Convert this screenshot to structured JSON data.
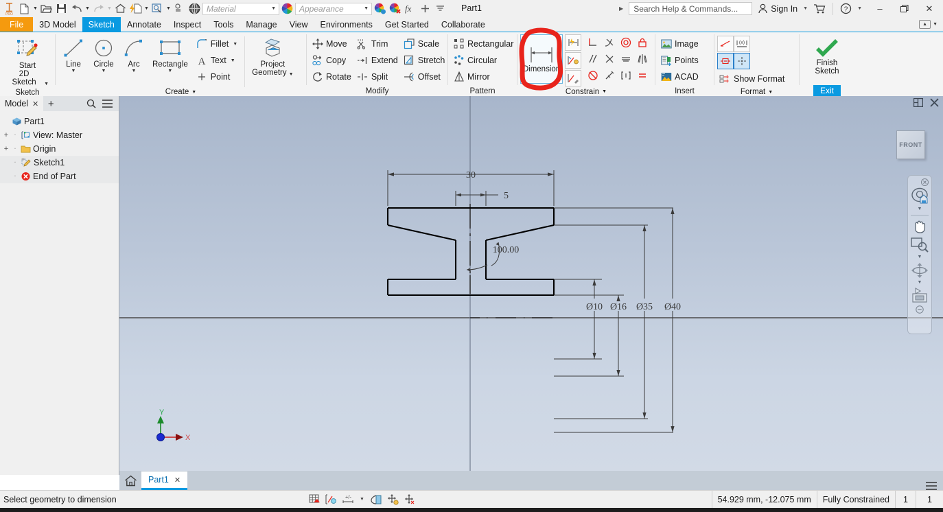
{
  "titlebar": {
    "document_title": "Part1",
    "search_placeholder": "Search Help & Commands...",
    "signin_label": "Sign In",
    "material_value": "Material",
    "appearance_value": "Appearance",
    "minimize": "–",
    "restore": "❐",
    "close": "✕",
    "qat_icons": [
      "new-document-icon",
      "open-folder-icon",
      "save-icon",
      "undo-icon",
      "redo-icon",
      "home-icon",
      "return-icon",
      "select-icon",
      "updates-icon",
      "material-sphere-icon",
      "appearance-sphere-icon",
      "adjust-appearance-icon",
      "clear-appearance-icon",
      "parameters-fx-icon",
      "add-icon",
      "more-icon"
    ]
  },
  "menubar": {
    "items": [
      {
        "label": "File",
        "state": "file"
      },
      {
        "label": "3D Model",
        "state": "normal"
      },
      {
        "label": "Sketch",
        "state": "active"
      },
      {
        "label": "Annotate",
        "state": "normal"
      },
      {
        "label": "Inspect",
        "state": "normal"
      },
      {
        "label": "Tools",
        "state": "normal"
      },
      {
        "label": "Manage",
        "state": "normal"
      },
      {
        "label": "View",
        "state": "normal"
      },
      {
        "label": "Environments",
        "state": "normal"
      },
      {
        "label": "Get Started",
        "state": "normal"
      },
      {
        "label": "Collaborate",
        "state": "normal"
      }
    ]
  },
  "ribbon": {
    "sketch_panel": {
      "label": "Sketch",
      "start_2d_sketch": {
        "line1": "Start",
        "line2": "2D Sketch"
      }
    },
    "create_panel": {
      "label": "Create",
      "line": "Line",
      "circle": "Circle",
      "arc": "Arc",
      "rectangle": "Rectangle",
      "fillet": "Fillet",
      "text": "Text",
      "point": "Point",
      "project_geometry": {
        "line1": "Project",
        "line2": "Geometry"
      }
    },
    "modify_panel": {
      "label": "Modify",
      "move": "Move",
      "copy": "Copy",
      "rotate": "Rotate",
      "trim": "Trim",
      "extend": "Extend",
      "split": "Split",
      "scale": "Scale",
      "stretch": "Stretch",
      "offset": "Offset"
    },
    "pattern_panel": {
      "label": "Pattern",
      "rectangular": "Rectangular",
      "circular": "Circular",
      "mirror": "Mirror"
    },
    "constrain_panel": {
      "label": "Constrain",
      "dimension": "Dimension",
      "highlighted": true,
      "icons": [
        "auto-dimension-icon",
        "show-constraints-icon",
        "constraint-settings-icon",
        "perpendicular-icon",
        "tangent-icon",
        "concentric-icon",
        "fix-icon",
        "parallel-icon",
        "coincident-icon",
        "collinear-icon",
        "symmetric-icon",
        "horizontal-icon",
        "vertical-icon",
        "smooth-icon",
        "equal-icon"
      ]
    },
    "insert_panel": {
      "label": "Insert",
      "image": "Image",
      "points": "Points",
      "acad": "ACAD"
    },
    "format_panel": {
      "label": "Format",
      "show_format": "Show Format",
      "icons": [
        "construction-line-icon",
        "driven-dimension-icon",
        "centerline-icon",
        "center-point-icon"
      ]
    },
    "exit_panel": {
      "finish_sketch": {
        "line1": "Finish",
        "line2": "Sketch"
      },
      "exit_label": "Exit"
    }
  },
  "browser": {
    "tab_label": "Model",
    "close_glyph": "✕",
    "add_glyph": "+",
    "search_icon": "search-icon",
    "menu_icon": "hamburger-icon",
    "tree": [
      {
        "label": "Part1",
        "icon": "part-cube-icon",
        "indent": 0,
        "expander": ""
      },
      {
        "label": "View: Master",
        "icon": "view-icon",
        "indent": 1,
        "expander": "+"
      },
      {
        "label": "Origin",
        "icon": "folder-icon",
        "indent": 1,
        "expander": "+"
      },
      {
        "label": "Sketch1",
        "icon": "sketch-icon",
        "indent": 1,
        "expander": ""
      },
      {
        "label": "End of Part",
        "icon": "end-of-part-icon",
        "indent": 1,
        "expander": ""
      }
    ]
  },
  "canvas": {
    "viewcube_label": "FRONT",
    "restore_panel_icon": "restore-panel-icon",
    "close_panel_icon": "close-panel-icon",
    "axis_x_label": "X",
    "axis_y_label": "Y",
    "nav_icons": [
      "navbar-close-icon",
      "steering-wheel-icon",
      "pan-hand-icon",
      "zoom-window-icon",
      "orbit-icon",
      "look-at-icon",
      "navbar-options-icon"
    ]
  },
  "sketch_dimensions": {
    "width_30": "30",
    "width_5": "5",
    "angle_100": "100.00",
    "dia_10": "Ø10",
    "dia_16": "Ø16",
    "dia_35": "Ø35",
    "dia_40": "Ø40"
  },
  "doctabs": {
    "home_icon": "home-icon",
    "tabs": [
      {
        "label": "Part1",
        "close": "✕",
        "active": true
      }
    ],
    "overflow_icon": "hamburger-icon"
  },
  "statusbar": {
    "message": "Select geometry to dimension",
    "coordinates": "54.929 mm, -12.075 mm",
    "constraint_state": "Fully Constrained",
    "dof_count": "1",
    "second_count": "1",
    "icons": [
      "grid-snap-icon",
      "constraint-visibility-icon",
      "dimension-display-icon",
      "slice-graphics-icon",
      "show-all-constraints-icon",
      "show-all-degrees-icon"
    ]
  },
  "colors": {
    "accent_blue": "#0a9ae1",
    "file_orange": "#f59a0e",
    "highlight_red": "#e8241c",
    "canvas_top": "#a8b6cb",
    "canvas_bottom": "#d2dae6"
  }
}
